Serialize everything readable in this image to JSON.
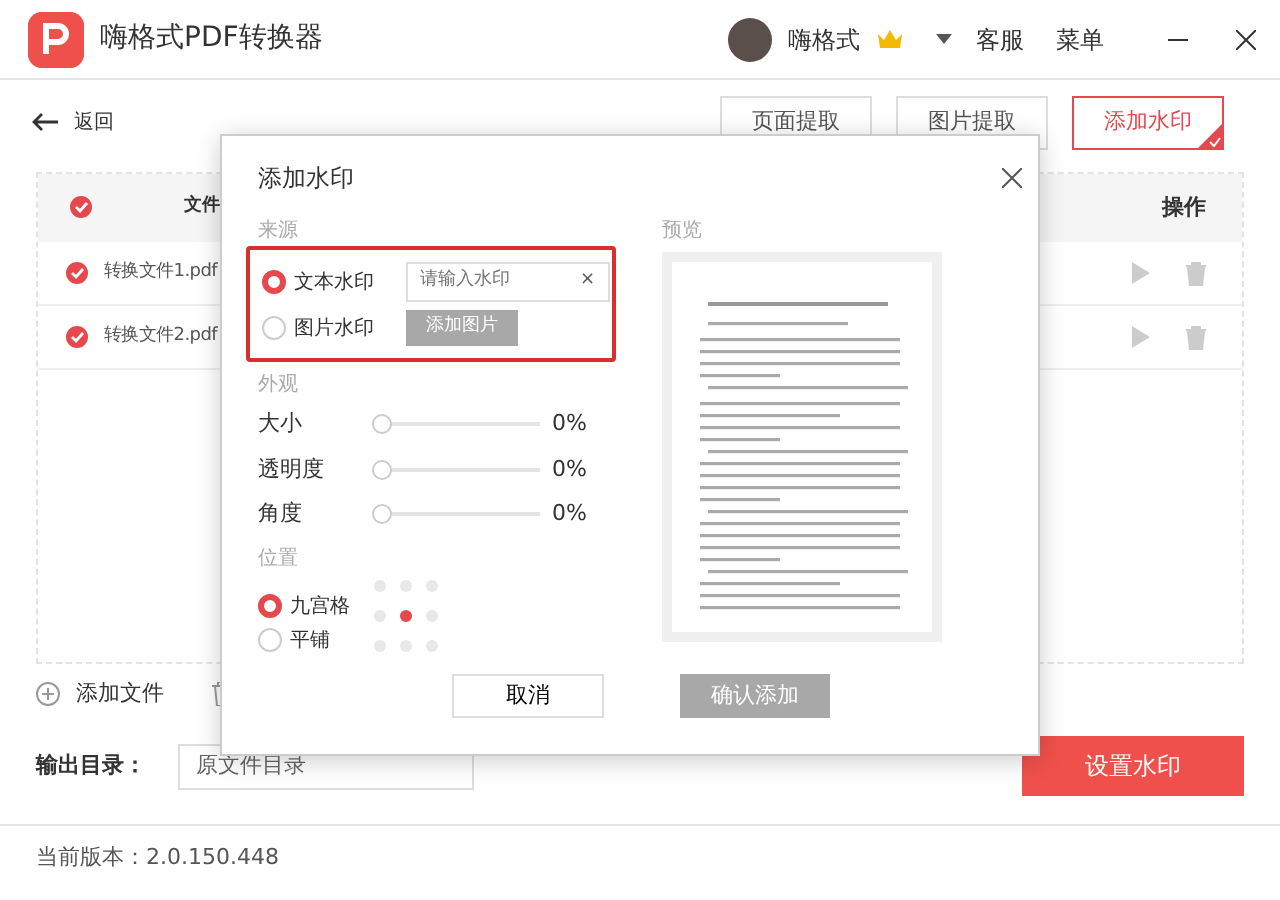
{
  "app": {
    "title": "嗨格式PDF转换器",
    "user": "嗨格式",
    "menu": [
      "客服",
      "菜单"
    ]
  },
  "back": "返回",
  "tabs": [
    {
      "label": "页面提取",
      "selected": false
    },
    {
      "label": "图片提取",
      "selected": false
    },
    {
      "label": "添加水印",
      "selected": true
    }
  ],
  "table": {
    "columns": [
      "文件",
      "操作"
    ],
    "all_checked": true,
    "rows": [
      {
        "name": "转换文件1.pdf",
        "checked": true
      },
      {
        "name": "转换文件2.pdf",
        "checked": true
      }
    ]
  },
  "toolbar": {
    "add": "添加文件"
  },
  "output": {
    "label": "输出目录：",
    "value": "原文件目录"
  },
  "primary": "设置水印",
  "version": "当前版本：2.0.150.448",
  "dialog": {
    "title": "添加水印",
    "source": {
      "heading": "来源",
      "options": [
        {
          "label": "文本水印",
          "selected": true,
          "kind": "text",
          "placeholder": "请输入水印",
          "clear": "×"
        },
        {
          "label": "图片水印",
          "selected": false,
          "kind": "image",
          "button": "添加图片"
        }
      ]
    },
    "appearance": {
      "heading": "外观",
      "sliders": [
        {
          "label": "大小",
          "level": 0,
          "reading": "0%"
        },
        {
          "label": "透明度",
          "level": 0,
          "reading": "0%"
        },
        {
          "label": "角度",
          "level": 0,
          "reading": "0%"
        }
      ]
    },
    "position": {
      "heading": "位置",
      "options": [
        {
          "label": "九宫格",
          "selected": true
        },
        {
          "label": "平铺",
          "selected": false
        }
      ],
      "grid": [
        {
          "selected": false
        },
        {
          "selected": false
        },
        {
          "selected": false
        },
        {
          "selected": false
        },
        {
          "selected": true
        },
        {
          "selected": false
        },
        {
          "selected": false
        },
        {
          "selected": false
        },
        {
          "selected": false
        }
      ]
    },
    "preview": {
      "heading": "预览"
    },
    "cancel": "取消",
    "confirm": {
      "label": "确认添加",
      "disabled": true
    }
  }
}
